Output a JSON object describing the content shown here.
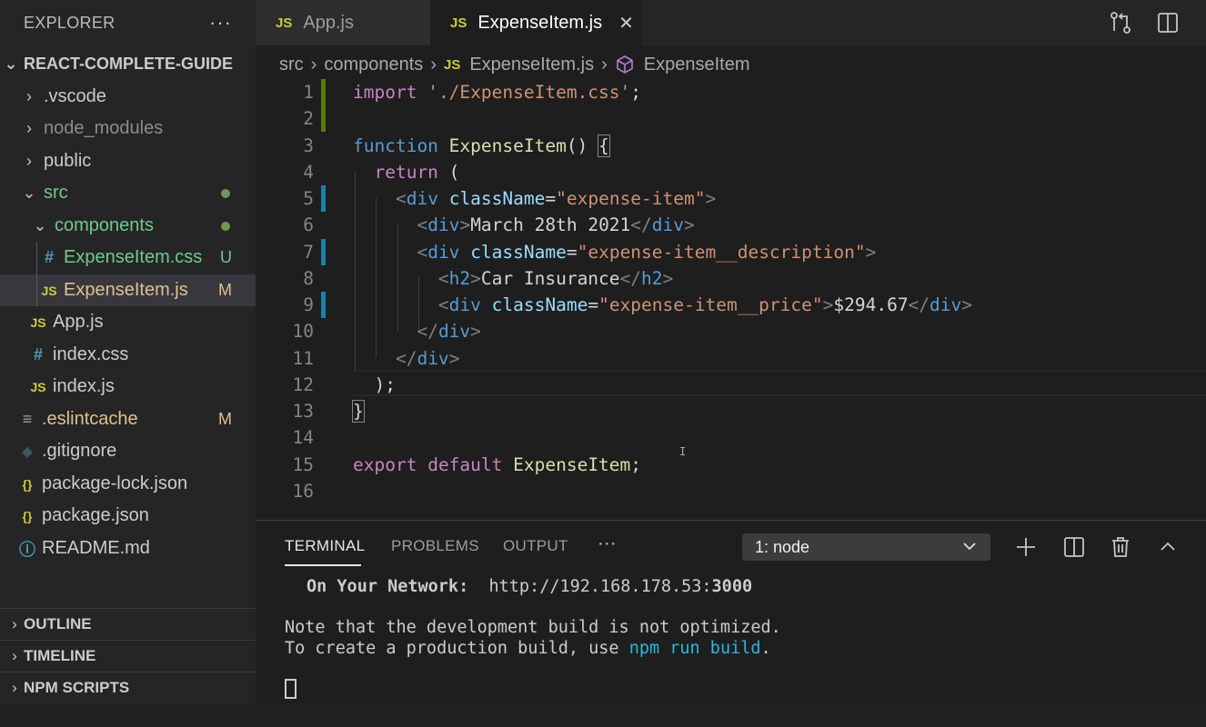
{
  "sidebar": {
    "title": "EXPLORER",
    "more": "···",
    "root": "REACT-COMPLETE-GUIDE",
    "items": [
      {
        "label": ".vscode"
      },
      {
        "label": "node_modules"
      },
      {
        "label": "public"
      },
      {
        "label": "src"
      },
      {
        "label": "components"
      },
      {
        "label": "ExpenseItem.css",
        "icon": "#",
        "badge": "U"
      },
      {
        "label": "ExpenseItem.js",
        "icon": "JS",
        "badge": "M"
      },
      {
        "label": "App.js",
        "icon": "JS"
      },
      {
        "label": "index.css",
        "icon": "#"
      },
      {
        "label": "index.js",
        "icon": "JS"
      },
      {
        "label": ".eslintcache",
        "icon": "≡",
        "badge": "M"
      },
      {
        "label": ".gitignore",
        "icon": "◆"
      },
      {
        "label": "package-lock.json",
        "icon": "{}"
      },
      {
        "label": "package.json",
        "icon": "{}"
      },
      {
        "label": "README.md",
        "icon": "ⓘ"
      }
    ],
    "sections": [
      "OUTLINE",
      "TIMELINE",
      "NPM SCRIPTS"
    ]
  },
  "tabs": [
    {
      "label": "App.js",
      "icon": "JS"
    },
    {
      "label": "ExpenseItem.js",
      "icon": "JS",
      "close": "✕"
    }
  ],
  "breadcrumb": [
    "src",
    "components",
    "ExpenseItem.js",
    "ExpenseItem"
  ],
  "editor": {
    "line_numbers": [
      "1",
      "2",
      "3",
      "4",
      "5",
      "6",
      "7",
      "8",
      "9",
      "10",
      "11",
      "12",
      "13",
      "14",
      "15",
      "16"
    ],
    "lines": [
      [
        [
          "k-ctrl",
          "import"
        ],
        [
          "k-txt",
          " "
        ],
        [
          "k-str",
          "'./ExpenseItem.css'"
        ],
        [
          "k-txt",
          ";"
        ]
      ],
      [],
      [
        [
          "k-kw",
          "function"
        ],
        [
          "k-txt",
          " "
        ],
        [
          "k-fn",
          "ExpenseItem"
        ],
        [
          "k-txt",
          "() "
        ],
        [
          "k-bra",
          "{"
        ]
      ],
      [
        [
          "k-txt",
          "  "
        ],
        [
          "k-ctrl",
          "return"
        ],
        [
          "k-txt",
          " ("
        ]
      ],
      [
        [
          "k-txt",
          "    "
        ],
        [
          "k-br",
          "<"
        ],
        [
          "k-tag",
          "div"
        ],
        [
          "k-txt",
          " "
        ],
        [
          "k-attr",
          "className"
        ],
        [
          "k-txt",
          "="
        ],
        [
          "k-str",
          "\"expense-item\""
        ],
        [
          "k-br",
          ">"
        ]
      ],
      [
        [
          "k-txt",
          "      "
        ],
        [
          "k-br",
          "<"
        ],
        [
          "k-tag",
          "div"
        ],
        [
          "k-br",
          ">"
        ],
        [
          "k-txt",
          "March 28th 2021"
        ],
        [
          "k-br",
          "</"
        ],
        [
          "k-tag",
          "div"
        ],
        [
          "k-br",
          ">"
        ]
      ],
      [
        [
          "k-txt",
          "      "
        ],
        [
          "k-br",
          "<"
        ],
        [
          "k-tag",
          "div"
        ],
        [
          "k-txt",
          " "
        ],
        [
          "k-attr",
          "className"
        ],
        [
          "k-txt",
          "="
        ],
        [
          "k-str",
          "\"expense-item__description\""
        ],
        [
          "k-br",
          ">"
        ]
      ],
      [
        [
          "k-txt",
          "        "
        ],
        [
          "k-br",
          "<"
        ],
        [
          "k-tag",
          "h2"
        ],
        [
          "k-br",
          ">"
        ],
        [
          "k-txt",
          "Car Insurance"
        ],
        [
          "k-br",
          "</"
        ],
        [
          "k-tag",
          "h2"
        ],
        [
          "k-br",
          ">"
        ]
      ],
      [
        [
          "k-txt",
          "        "
        ],
        [
          "k-br",
          "<"
        ],
        [
          "k-tag",
          "div"
        ],
        [
          "k-txt",
          " "
        ],
        [
          "k-attr",
          "className"
        ],
        [
          "k-txt",
          "="
        ],
        [
          "k-str",
          "\"expense-item__price\""
        ],
        [
          "k-br",
          ">"
        ],
        [
          "k-txt",
          "$294.67"
        ],
        [
          "k-br",
          "</"
        ],
        [
          "k-tag",
          "div"
        ],
        [
          "k-br",
          ">"
        ]
      ],
      [
        [
          "k-txt",
          "      "
        ],
        [
          "k-br",
          "</"
        ],
        [
          "k-tag",
          "div"
        ],
        [
          "k-br",
          ">"
        ]
      ],
      [
        [
          "k-txt",
          "    "
        ],
        [
          "k-br",
          "</"
        ],
        [
          "k-tag",
          "div"
        ],
        [
          "k-br",
          ">"
        ]
      ],
      [
        [
          "k-txt",
          "  );"
        ]
      ],
      [
        [
          "k-bra",
          "}"
        ]
      ],
      [],
      [
        [
          "k-ctrl",
          "export"
        ],
        [
          "k-txt",
          " "
        ],
        [
          "k-ctrl",
          "default"
        ],
        [
          "k-txt",
          " "
        ],
        [
          "k-fn",
          "ExpenseItem"
        ],
        [
          "k-txt",
          ";"
        ]
      ],
      []
    ]
  },
  "panel": {
    "tabs": [
      "TERMINAL",
      "PROBLEMS",
      "OUTPUT"
    ],
    "more": "···",
    "terminal_select": "1: node",
    "terminal": {
      "network_label": "On Your Network:",
      "network_url_pre": "http://192.168.178.53:",
      "network_port": "3000",
      "note1": "Note that the development build is not optimized.",
      "note2_pre": "To create a production build, use ",
      "note2_cmd": "npm run build",
      "note2_post": "."
    }
  }
}
